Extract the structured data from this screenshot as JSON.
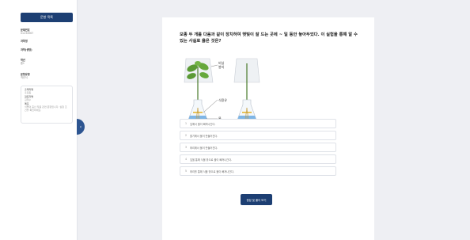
{
  "sidebar": {
    "start_button": "문항 목록",
    "fields": [
      {
        "label": "문제번호",
        "value": "01234567"
      },
      {
        "label": "과목명",
        "value": ""
      },
      {
        "label": "과학(생명)",
        "value": ""
      },
      {
        "label": "학년",
        "value": "중1"
      },
      {
        "label": "단원명",
        "value": ""
      },
      {
        "label": "문항유형",
        "value": "객관식"
      }
    ],
    "card": [
      {
        "label": "출제자명",
        "value": "홍길동"
      },
      {
        "label": "검토자명",
        "value": "김철수"
      },
      {
        "label": "메모",
        "value": "식물의 증산 작용 관련 문항입니다. 실험 조건을 확인하세요."
      }
    ],
    "toggle_icon": "‹"
  },
  "question": {
    "title": "모종 두 개를 다음과 같이 장치하여 햇빛이 잘 드는 곳에 ~ 일 동안 놓아두었다. 이 실험을 통해 알 수 있는 사실로 옳은 것은?",
    "figure_labels": {
      "bag": "비닐\n봉지",
      "bag_line1": "비닐",
      "bag_line2": "봉지",
      "oil": "식용유",
      "water": "물"
    },
    "options": [
      {
        "num": "1",
        "text": "잎에서 물이 빠져나간다."
      },
      {
        "num": "2",
        "text": "줄기에서 물이 만들어진다."
      },
      {
        "num": "3",
        "text": "뿌리에서 물이 만들어진다."
      },
      {
        "num": "4",
        "text": "잎을 통해 식물 밖으로 물이 빠져나간다."
      },
      {
        "num": "5",
        "text": "뿌리를 통해 식물 밖으로 물이 빠져나간다."
      }
    ],
    "submit_label": "정답 및 풀이 보기"
  },
  "colors": {
    "primary": "#1d3f73",
    "handle": "#2d5591",
    "background": "#eeeff3"
  }
}
